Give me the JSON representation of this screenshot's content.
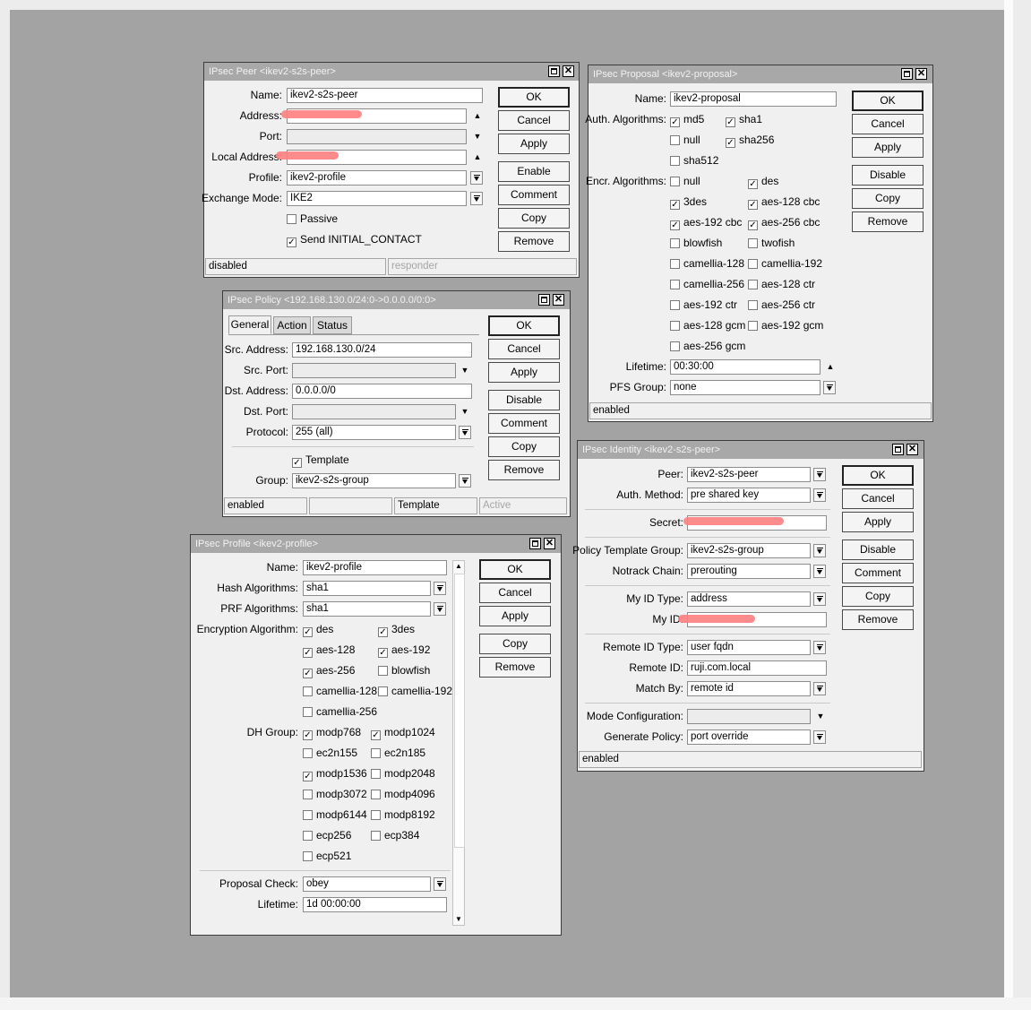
{
  "peer": {
    "title": "IPsec Peer <ikev2-s2s-peer>",
    "name_label": "Name:",
    "name": "ikev2-s2s-peer",
    "address_label": "Address:",
    "address": "",
    "port_label": "Port:",
    "port": "",
    "local_address_label": "Local Address:",
    "local_address": "",
    "profile_label": "Profile:",
    "profile": "ikev2-profile",
    "exchange_mode_label": "Exchange Mode:",
    "exchange_mode": "IKE2",
    "passive_label": "Passive",
    "passive": false,
    "send_initial_label": "Send INITIAL_CONTACT",
    "send_initial": true,
    "buttons": [
      "OK",
      "Cancel",
      "Apply",
      "Enable",
      "Comment",
      "Copy",
      "Remove"
    ],
    "status_left": "disabled",
    "status_right": "responder"
  },
  "policy": {
    "title": "IPsec Policy <192.168.130.0/24:0->0.0.0.0/0:0>",
    "tabs": [
      "General",
      "Action",
      "Status"
    ],
    "src_address_label": "Src. Address:",
    "src_address": "192.168.130.0/24",
    "src_port_label": "Src. Port:",
    "src_port": "",
    "dst_address_label": "Dst. Address:",
    "dst_address": "0.0.0.0/0",
    "dst_port_label": "Dst. Port:",
    "dst_port": "",
    "protocol_label": "Protocol:",
    "protocol": "255 (all)",
    "template_label": "Template",
    "template": true,
    "group_label": "Group:",
    "group": "ikev2-s2s-group",
    "buttons": [
      "OK",
      "Cancel",
      "Apply",
      "Disable",
      "Comment",
      "Copy",
      "Remove"
    ],
    "status": [
      "enabled",
      "",
      "Template",
      "Active"
    ]
  },
  "profile": {
    "title": "IPsec Profile <ikev2-profile>",
    "name_label": "Name:",
    "name": "ikev2-profile",
    "hash_label": "Hash Algorithms:",
    "hash": "sha1",
    "prf_label": "PRF Algorithms:",
    "prf": "sha1",
    "enc_label": "Encryption Algorithm:",
    "enc": [
      {
        "label": "des",
        "checked": true
      },
      {
        "label": "3des",
        "checked": true
      },
      {
        "label": "aes-128",
        "checked": true
      },
      {
        "label": "aes-192",
        "checked": true
      },
      {
        "label": "aes-256",
        "checked": true
      },
      {
        "label": "blowfish",
        "checked": false
      },
      {
        "label": "camellia-128",
        "checked": false
      },
      {
        "label": "camellia-192",
        "checked": false
      },
      {
        "label": "camellia-256",
        "checked": false
      }
    ],
    "dh_label": "DH Group:",
    "dh": [
      {
        "label": "modp768",
        "checked": true
      },
      {
        "label": "modp1024",
        "checked": true
      },
      {
        "label": "ec2n155",
        "checked": false
      },
      {
        "label": "ec2n185",
        "checked": false
      },
      {
        "label": "modp1536",
        "checked": true
      },
      {
        "label": "modp2048",
        "checked": false
      },
      {
        "label": "modp3072",
        "checked": false
      },
      {
        "label": "modp4096",
        "checked": false
      },
      {
        "label": "modp6144",
        "checked": false
      },
      {
        "label": "modp8192",
        "checked": false
      },
      {
        "label": "ecp256",
        "checked": false
      },
      {
        "label": "ecp384",
        "checked": false
      },
      {
        "label": "ecp521",
        "checked": false
      }
    ],
    "proposal_check_label": "Proposal Check:",
    "proposal_check": "obey",
    "lifetime_label": "Lifetime:",
    "lifetime": "1d 00:00:00",
    "buttons": [
      "OK",
      "Cancel",
      "Apply",
      "Copy",
      "Remove"
    ]
  },
  "proposal": {
    "title": "IPsec Proposal <ikev2-proposal>",
    "name_label": "Name:",
    "name": "ikev2-proposal",
    "auth_label": "Auth. Algorithms:",
    "auth": [
      {
        "label": "md5",
        "checked": true
      },
      {
        "label": "sha1",
        "checked": true
      },
      {
        "label": "null",
        "checked": false
      },
      {
        "label": "sha256",
        "checked": true
      },
      {
        "label": "sha512",
        "checked": false
      }
    ],
    "encr_label": "Encr. Algorithms:",
    "encr": [
      {
        "label": "null",
        "checked": false
      },
      {
        "label": "des",
        "checked": true
      },
      {
        "label": "3des",
        "checked": true
      },
      {
        "label": "aes-128 cbc",
        "checked": true
      },
      {
        "label": "aes-192 cbc",
        "checked": true
      },
      {
        "label": "aes-256 cbc",
        "checked": true
      },
      {
        "label": "blowfish",
        "checked": false
      },
      {
        "label": "twofish",
        "checked": false
      },
      {
        "label": "camellia-128",
        "checked": false
      },
      {
        "label": "camellia-192",
        "checked": false
      },
      {
        "label": "camellia-256",
        "checked": false
      },
      {
        "label": "aes-128 ctr",
        "checked": false
      },
      {
        "label": "aes-192 ctr",
        "checked": false
      },
      {
        "label": "aes-256 ctr",
        "checked": false
      },
      {
        "label": "aes-128 gcm",
        "checked": false
      },
      {
        "label": "aes-192 gcm",
        "checked": false
      },
      {
        "label": "aes-256 gcm",
        "checked": false
      }
    ],
    "lifetime_label": "Lifetime:",
    "lifetime": "00:30:00",
    "pfs_label": "PFS Group:",
    "pfs": "none",
    "buttons": [
      "OK",
      "Cancel",
      "Apply",
      "Disable",
      "Copy",
      "Remove"
    ],
    "status": "enabled"
  },
  "identity": {
    "title": "IPsec Identity <ikev2-s2s-peer>",
    "peer_label": "Peer:",
    "peer": "ikev2-s2s-peer",
    "auth_method_label": "Auth. Method:",
    "auth_method": "pre shared key",
    "secret_label": "Secret:",
    "secret": "",
    "ptg_label": "Policy Template Group:",
    "ptg": "ikev2-s2s-group",
    "notrack_label": "Notrack Chain:",
    "notrack": "prerouting",
    "my_id_type_label": "My ID Type:",
    "my_id_type": "address",
    "my_id_label": "My ID:",
    "my_id": "",
    "remote_id_type_label": "Remote ID Type:",
    "remote_id_type": "user fqdn",
    "remote_id_label": "Remote ID:",
    "remote_id": "ruji.com.local",
    "match_by_label": "Match By:",
    "match_by": "remote id",
    "mode_config_label": "Mode Configuration:",
    "mode_config": "",
    "gen_policy_label": "Generate Policy:",
    "gen_policy": "port override",
    "buttons": [
      "OK",
      "Cancel",
      "Apply",
      "Disable",
      "Comment",
      "Copy",
      "Remove"
    ],
    "status": "enabled"
  }
}
